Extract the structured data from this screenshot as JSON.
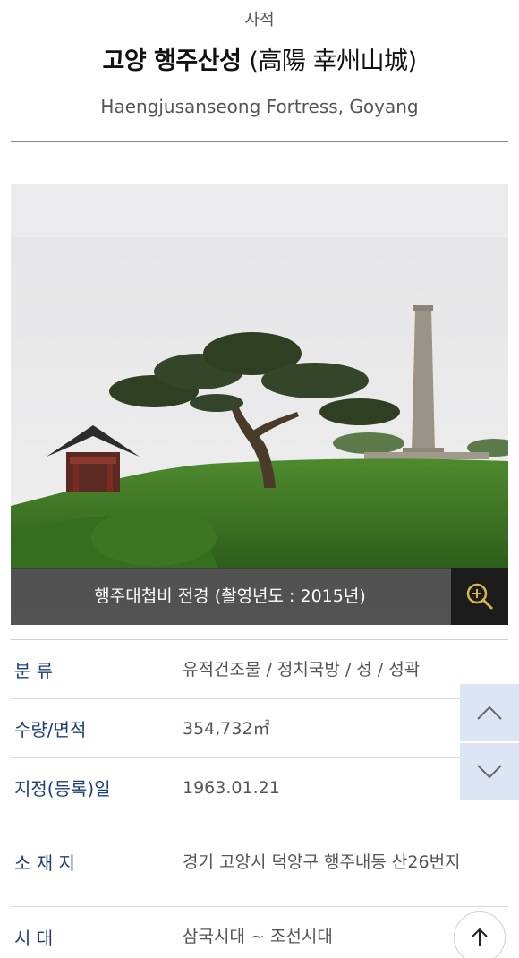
{
  "header": {
    "category": "사적",
    "title_ko": "고양 행주산성",
    "title_hanja": "(高陽 幸州山城)",
    "title_en": "Haengjusanseong Fortress, Goyang"
  },
  "photo": {
    "caption": "행주대첩비 전경 (촬영년도 : 2015년)",
    "zoom_icon": "zoom-in-icon"
  },
  "info": {
    "rows": [
      {
        "label": "분 류",
        "value": "유적건조물 / 정치국방 / 성 / 성곽"
      },
      {
        "label": "수량/면적",
        "value": "354,732㎡"
      },
      {
        "label": "지정(등록)일",
        "value": "1963.01.21"
      },
      {
        "label": "소 재 지",
        "value": "경기 고양시 덕양구 행주내동 산26번지"
      },
      {
        "label": "시 대",
        "value": "삼국시대 ~ 조선시대"
      }
    ]
  },
  "controls": {
    "scroll_up_icon": "chevron-up-icon",
    "scroll_down_icon": "chevron-down-icon",
    "back_to_top_icon": "arrow-up-icon"
  }
}
